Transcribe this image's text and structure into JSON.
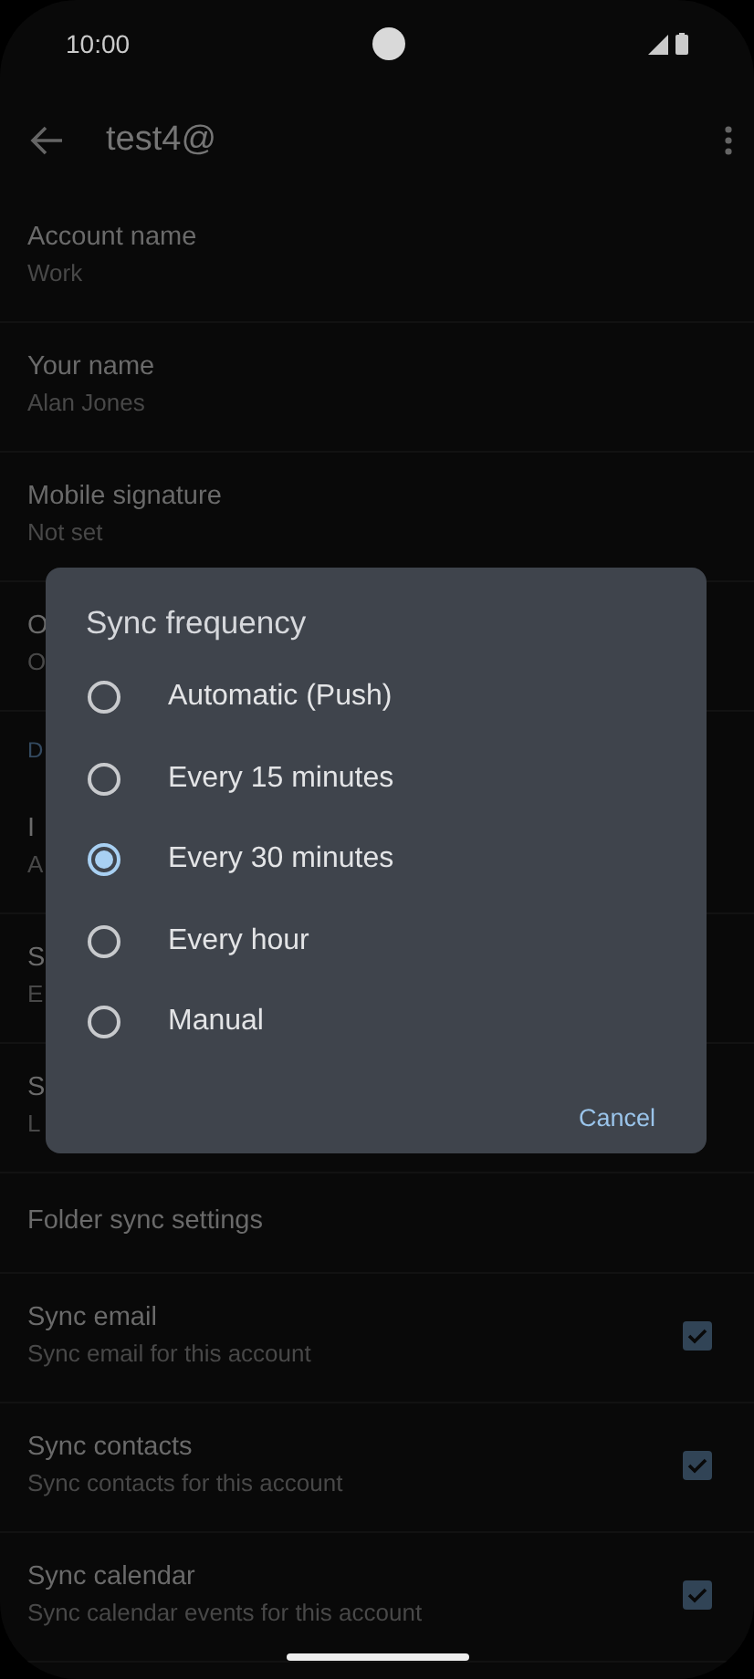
{
  "status_bar": {
    "time": "10:00"
  },
  "app_bar": {
    "title": "test4@"
  },
  "settings": [
    {
      "kind": "item",
      "title": "Account name",
      "summary": "Work"
    },
    {
      "kind": "item",
      "title": "Your name",
      "summary": "Alan Jones"
    },
    {
      "kind": "item",
      "title": "Mobile signature",
      "summary": "Not set"
    },
    {
      "kind": "item",
      "title": "O",
      "summary": "O"
    },
    {
      "kind": "header",
      "title": "D"
    },
    {
      "kind": "item",
      "title": "I",
      "summary": "A"
    },
    {
      "kind": "item",
      "title": "S",
      "summary": "E"
    },
    {
      "kind": "item",
      "title": "S",
      "summary": "L"
    },
    {
      "kind": "item",
      "title": "Folder sync settings"
    },
    {
      "kind": "checkbox",
      "title": "Sync email",
      "summary": "Sync email for this account",
      "checked": true
    },
    {
      "kind": "checkbox",
      "title": "Sync contacts",
      "summary": "Sync contacts for this account",
      "checked": true
    },
    {
      "kind": "checkbox",
      "title": "Sync calendar",
      "summary": "Sync calendar events for this account",
      "checked": true
    }
  ],
  "dialog": {
    "title": "Sync frequency",
    "options": [
      {
        "label": "Automatic (Push)",
        "selected": false
      },
      {
        "label": "Every 15 minutes",
        "selected": false
      },
      {
        "label": "Every 30 minutes",
        "selected": true
      },
      {
        "label": "Every hour",
        "selected": false
      },
      {
        "label": "Manual",
        "selected": false
      }
    ],
    "button": "Cancel"
  }
}
